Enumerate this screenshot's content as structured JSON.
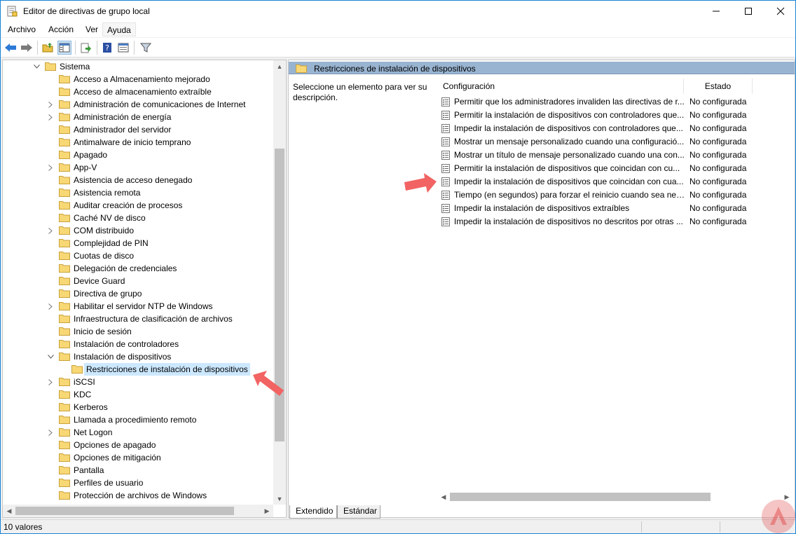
{
  "window": {
    "title": "Editor de directivas de grupo local"
  },
  "menu": [
    "Archivo",
    "Acción",
    "Ver",
    "Ayuda"
  ],
  "toolbar": {
    "icons": [
      "back-icon",
      "forward-icon",
      "up-folder-icon",
      "show-hide-tree-icon",
      "export-list-icon",
      "help-icon",
      "properties-icon",
      "filter-icon"
    ]
  },
  "tree": {
    "parent": "Sistema",
    "items": [
      {
        "label": "Acceso a Almacenamiento mejorado",
        "expandable": false
      },
      {
        "label": "Acceso de almacenamiento extraíble",
        "expandable": false
      },
      {
        "label": "Administración de comunicaciones de Internet",
        "expandable": true
      },
      {
        "label": "Administración de energía",
        "expandable": true
      },
      {
        "label": "Administrador del servidor",
        "expandable": false
      },
      {
        "label": "Antimalware de inicio temprano",
        "expandable": false
      },
      {
        "label": "Apagado",
        "expandable": false
      },
      {
        "label": "App-V",
        "expandable": true
      },
      {
        "label": "Asistencia de acceso denegado",
        "expandable": false
      },
      {
        "label": "Asistencia remota",
        "expandable": false
      },
      {
        "label": "Auditar creación de procesos",
        "expandable": false
      },
      {
        "label": "Caché NV de disco",
        "expandable": false
      },
      {
        "label": "COM distribuido",
        "expandable": true
      },
      {
        "label": "Complejidad de PIN",
        "expandable": false
      },
      {
        "label": "Cuotas de disco",
        "expandable": false
      },
      {
        "label": "Delegación de credenciales",
        "expandable": false
      },
      {
        "label": "Device Guard",
        "expandable": false
      },
      {
        "label": "Directiva de grupo",
        "expandable": false
      },
      {
        "label": "Habilitar el servidor NTP de Windows",
        "expandable": true
      },
      {
        "label": "Infraestructura de clasificación de archivos",
        "expandable": false
      },
      {
        "label": "Inicio de sesión",
        "expandable": false
      },
      {
        "label": "Instalación de controladores",
        "expandable": false
      },
      {
        "label": "Instalación de dispositivos",
        "expandable": true,
        "expanded": true
      },
      {
        "label": "Restricciones de instalación de dispositivos",
        "expandable": false,
        "child": true,
        "selected": true
      },
      {
        "label": "iSCSI",
        "expandable": true
      },
      {
        "label": "KDC",
        "expandable": false
      },
      {
        "label": "Kerberos",
        "expandable": false
      },
      {
        "label": "Llamada a procedimiento remoto",
        "expandable": false
      },
      {
        "label": "Net Logon",
        "expandable": true
      },
      {
        "label": "Opciones de apagado",
        "expandable": false
      },
      {
        "label": "Opciones de mitigación",
        "expandable": false
      },
      {
        "label": "Pantalla",
        "expandable": false
      },
      {
        "label": "Perfiles de usuario",
        "expandable": false
      },
      {
        "label": "Protección de archivos de Windows",
        "expandable": false
      }
    ]
  },
  "right": {
    "header": "Restricciones de instalación de dispositivos",
    "description": "Seleccione un elemento para ver su descripción.",
    "columns": [
      "Configuración",
      "Estado"
    ],
    "policies": [
      {
        "name": "Permitir que los administradores invaliden las directivas de r...",
        "state": "No configurada"
      },
      {
        "name": "Permitir la instalación de dispositivos con controladores que...",
        "state": "No configurada"
      },
      {
        "name": "Impedir la instalación de dispositivos con controladores que...",
        "state": "No configurada"
      },
      {
        "name": "Mostrar un mensaje personalizado cuando una configuració...",
        "state": "No configurada"
      },
      {
        "name": "Mostrar un título de mensaje personalizado cuando una con...",
        "state": "No configurada"
      },
      {
        "name": "Permitir la instalación de dispositivos que coincidan con cu...",
        "state": "No configurada"
      },
      {
        "name": "Impedir la instalación de dispositivos que coincidan con cua...",
        "state": "No configurada"
      },
      {
        "name": "Tiempo (en segundos) para forzar el reinicio cuando sea nec...",
        "state": "No configurada"
      },
      {
        "name": "Impedir la instalación de dispositivos extraíbles",
        "state": "No configurada"
      },
      {
        "name": "Impedir la instalación de dispositivos no descritos por otras ...",
        "state": "No configurada"
      }
    ]
  },
  "tabs": [
    "Extendido",
    "Estándar"
  ],
  "status": "10 valores",
  "colors": {
    "accent": "#99b4d1",
    "selection": "#cce8ff",
    "arrow": "#f05a5a"
  }
}
